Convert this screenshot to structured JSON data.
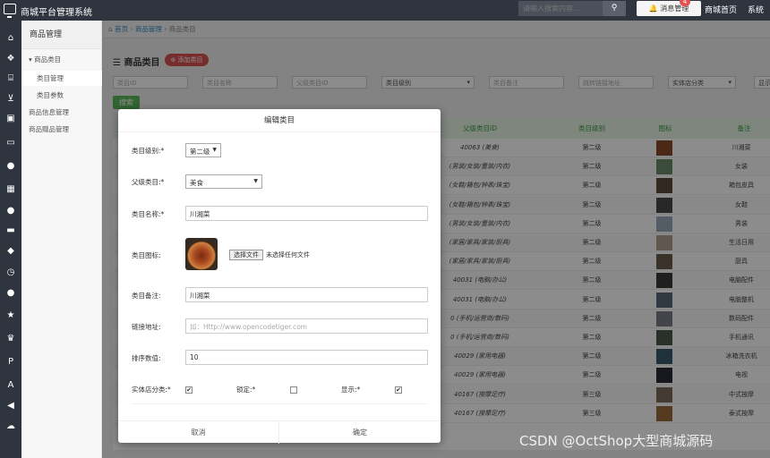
{
  "topbar": {
    "title": "商城平台管理系统",
    "search_placeholder": "请输入搜索内容...",
    "search_icon": "search-icon",
    "msg_label": "消息管理",
    "msg_count": "4",
    "link_home": "商城首页",
    "link_system": "系统"
  },
  "iconbar": [
    "home-icon",
    "cubes-icon",
    "bank-icon",
    "cart-icon",
    "gift-icon",
    "money-icon",
    "user-icon",
    "calculator-icon",
    "comment-icon",
    "truck-icon",
    "thumbs-icon",
    "clock-icon",
    "users-icon",
    "star-icon",
    "trophy-icon",
    "paypal-icon",
    "font-icon",
    "volume-icon",
    "cloud-icon"
  ],
  "sidebar": {
    "header": "商品管理",
    "items": [
      {
        "label": "▾ 商品类目"
      },
      {
        "label": "类目管理"
      },
      {
        "label": "类目参数"
      },
      {
        "label": "商品信息管理"
      },
      {
        "label": "商品赠品管理"
      }
    ]
  },
  "breadcrumb": {
    "home": "首页",
    "sep": "›",
    "b1": "商品管理",
    "b2": "商品类目"
  },
  "page": {
    "title": "商品类目",
    "add_label": "添加类目",
    "search_label": "搜索"
  },
  "filters": {
    "category_id": "类目ID",
    "category_name": "类目名称",
    "parent_id": "父级类目ID",
    "level": "类目级别",
    "remark": "类目备注",
    "link": "跳转链接地址",
    "store": "实体店分类",
    "show": "显示"
  },
  "table": {
    "headers": {
      "parent": "父级类目ID",
      "level": "类目级别",
      "icon": "图标",
      "remark": "备注"
    },
    "rows": [
      {
        "parent": "40063 (美食)",
        "level": "第二级",
        "remark": "川湘菜"
      },
      {
        "parent": "(男装/女装/童装/内衣)",
        "level": "第二级",
        "remark": "女装"
      },
      {
        "parent": "(女鞋/箱包/钟表/珠宝)",
        "level": "第二级",
        "remark": "箱包皮具"
      },
      {
        "parent": "(女鞋/箱包/钟表/珠宝)",
        "level": "第二级",
        "remark": "女鞋"
      },
      {
        "parent": "(男装/女装/童装/内衣)",
        "level": "第二级",
        "remark": "男装"
      },
      {
        "parent": "(家居/家具/家装/厨具)",
        "level": "第二级",
        "remark": "生活日用"
      },
      {
        "parent": "(家居/家具/家装/厨具)",
        "level": "第二级",
        "remark": "厨具"
      },
      {
        "parent": "40031 (电脑/办公)",
        "level": "第二级",
        "remark": "电脑配件"
      },
      {
        "parent": "40031 (电脑/办公)",
        "level": "第二级",
        "remark": "电脑整机"
      },
      {
        "parent": "0 (手机/运营商/数码)",
        "level": "第二级",
        "remark": "数码配件"
      },
      {
        "parent": "0 (手机/运营商/数码)",
        "level": "第二级",
        "remark": "手机通讯"
      },
      {
        "parent": "40029 (家用电器)",
        "level": "第二级",
        "remark": "冰箱洗衣机"
      },
      {
        "parent": "40029 (家用电器)",
        "level": "第二级",
        "remark": "电视"
      },
      {
        "parent": "40167 (按摩足疗)",
        "level": "第三级",
        "remark": "中式按摩"
      },
      {
        "parent": "40167 (按摩足疗)",
        "level": "第三级",
        "remark": "泰式按摩"
      }
    ]
  },
  "modal": {
    "title": "编辑类目",
    "level_label": "类目级别:*",
    "level_value": "第二级",
    "parent_label": "父级类目:*",
    "parent_value": "美食",
    "name_label": "类目名称:*",
    "name_value": "川湘菜",
    "icon_label": "类目图标:",
    "file_btn": "选择文件",
    "file_status": "未选择任何文件",
    "remark_label": "类目备注:",
    "remark_value": "川湘菜",
    "link_label": "链接地址:",
    "link_placeholder": "如：Http://www.opencodetiger.com",
    "order_label": "排序数值:",
    "order_value": "10",
    "store_label": "实体店分类:*",
    "lock_label": "锁定:*",
    "show_label": "显示:*",
    "store_checked": true,
    "lock_checked": false,
    "show_checked": true,
    "cancel": "取消",
    "confirm": "确定"
  },
  "watermark": "CSDN @OctShop大型商城源码"
}
